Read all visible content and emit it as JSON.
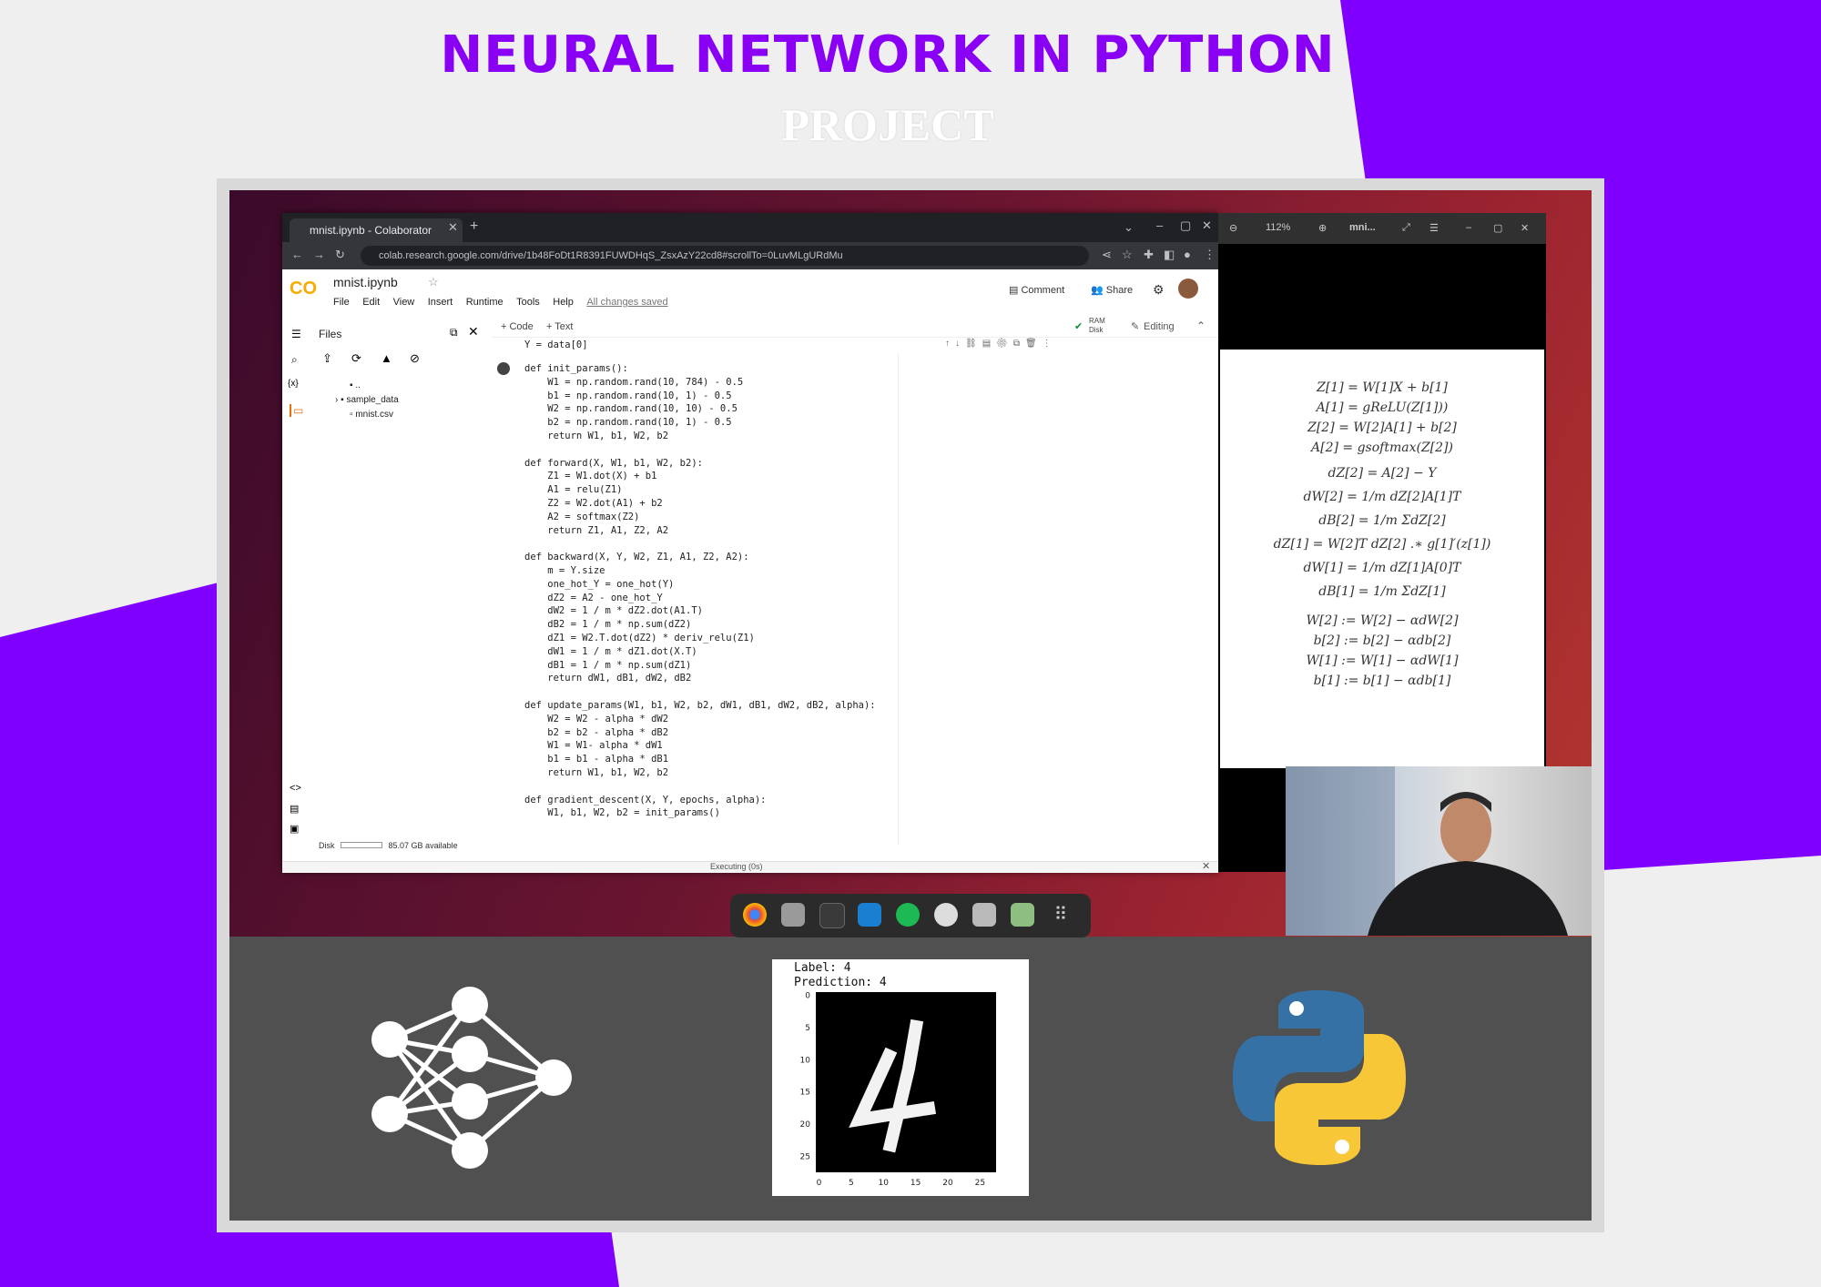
{
  "banner": {
    "title": "NEURAL NETWORK IN PYTHON",
    "subtitle": "PROJECT"
  },
  "browser": {
    "tab_title": "mnist.ipynb - Colaborator",
    "url": "colab.research.google.com/drive/1b48FoDt1R8391FUWDHqS_ZsxAzY22cd8#scrollTo=0LuvMLgURdMu",
    "notebook_name": "mnist.ipynb",
    "menu": [
      "File",
      "Edit",
      "View",
      "Insert",
      "Runtime",
      "Tools",
      "Help"
    ],
    "saved_status": "All changes saved",
    "comment_label": "Comment",
    "share_label": "Share",
    "add_code": "+ Code",
    "add_text": "+ Text",
    "ram_label": "RAM",
    "disk_label": "Disk",
    "editing_label": "Editing",
    "files_title": "Files",
    "file_tree": [
      "..",
      "sample_data",
      "mnist.csv"
    ],
    "disk_footer_label": "Disk",
    "disk_available": "85.07 GB available",
    "executing": "Executing (0s)"
  },
  "notebook": {
    "prev_cell": "Y = data[0]",
    "code_lines": [
      "def init_params():",
      "    W1 = np.random.rand(10, 784) - 0.5",
      "    b1 = np.random.rand(10, 1) - 0.5",
      "    W2 = np.random.rand(10, 10) - 0.5",
      "    b2 = np.random.rand(10, 1) - 0.5",
      "    return W1, b1, W2, b2",
      "",
      "def forward(X, W1, b1, W2, b2):",
      "    Z1 = W1.dot(X) + b1",
      "    A1 = relu(Z1)",
      "    Z2 = W2.dot(A1) + b2",
      "    A2 = softmax(Z2)",
      "    return Z1, A1, Z2, A2",
      "",
      "def backward(X, Y, W2, Z1, A1, Z2, A2):",
      "    m = Y.size",
      "    one_hot_Y = one_hot(Y)",
      "    dZ2 = A2 - one_hot_Y",
      "    dW2 = 1 / m * dZ2.dot(A1.T)",
      "    dB2 = 1 / m * np.sum(dZ2)",
      "    dZ1 = W2.T.dot(dZ2) * deriv_relu(Z1)",
      "    dW1 = 1 / m * dZ1.dot(X.T)",
      "    dB1 = 1 / m * np.sum(dZ1)",
      "    return dW1, dB1, dW2, dB2",
      "",
      "def update_params(W1, b1, W2, b2, dW1, dB1, dW2, dB2, alpha):",
      "    W2 = W2 - alpha * dW2",
      "    b2 = b2 - alpha * dB2",
      "    W1 = W1- alpha * dW1",
      "    b1 = b1 - alpha * dB1",
      "    return W1, b1, W2, b2",
      "",
      "def gradient_descent(X, Y, epochs, alpha):",
      "    W1, b1, W2, b2 = init_params()"
    ]
  },
  "pdf_viewer": {
    "zoom": "112%",
    "doc_title": "mni...",
    "equations_forward": [
      "Z[1] = W[1]X + b[1]",
      "A[1] = gReLU(Z[1]))",
      "Z[2] = W[2]A[1] + b[2]",
      "A[2] = gsoftmax(Z[2])"
    ],
    "equations_backward": [
      "dZ[2] = A[2] − Y",
      "dW[2] = 1/m dZ[2]A[1]T",
      "dB[2] = 1/m ΣdZ[2]",
      "dZ[1] = W[2]T dZ[2] .∗ g[1]′(z[1])",
      "dW[1] = 1/m dZ[1]A[0]T",
      "dB[1] = 1/m ΣdZ[1]"
    ],
    "equations_update": [
      "W[2] := W[2] − αdW[2]",
      "b[2] := b[2] − αdb[2]",
      "W[1] := W[1] − αdW[1]",
      "b[1] := b[1] − αdb[1]"
    ]
  },
  "mnist": {
    "label_text": "Label:  4",
    "prediction_text": "Prediction:  4",
    "y_ticks": [
      "0",
      "5",
      "10",
      "15",
      "20",
      "25"
    ],
    "x_ticks": [
      "0",
      "5",
      "10",
      "15",
      "20",
      "25"
    ]
  },
  "colors": {
    "purple": "#8a00f5",
    "violet_bg": "#7f00ff",
    "python_blue": "#3671a6",
    "python_yellow": "#f7c737"
  },
  "icons": {
    "neural_net": "neural-network-icon",
    "python": "python-logo-icon"
  }
}
